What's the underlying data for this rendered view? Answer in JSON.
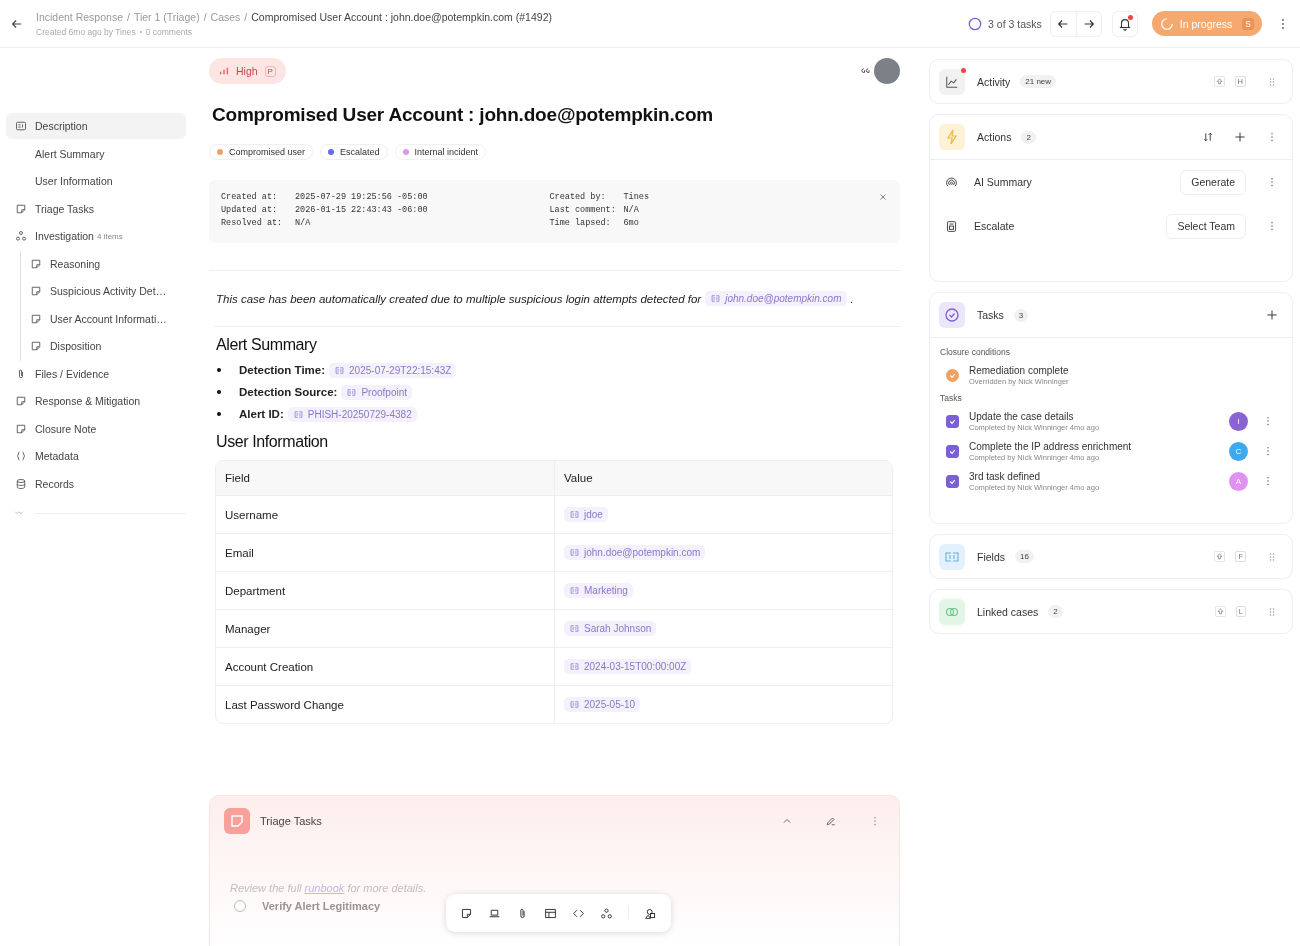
{
  "header": {
    "breadcrumb": [
      "Incident Response",
      "Tier 1 (Triage)",
      "Cases"
    ],
    "separator": "/",
    "tasks": {
      "label": "3 of 3 tasks"
    },
    "current": "Compromised User Account : john.doe@potempkin.com (#1492)",
    "created": "Created 6mo ago by Tines",
    "comments": "0 comments",
    "notifications_unread": true,
    "status": "In progress",
    "status_key": "S"
  },
  "sidebar": {
    "items": [
      {
        "label": "Description",
        "kind": "card",
        "selected": true,
        "children": [
          {
            "label": "Alert Summary",
            "kind": "plain",
            "selected": false
          },
          {
            "label": "User Information",
            "kind": "plain",
            "selected": false
          }
        ]
      },
      {
        "label": "Triage Tasks",
        "kind": "note",
        "selected": false
      },
      {
        "label": "Investigation",
        "count": "4 items",
        "kind": "graph",
        "selected": false,
        "children": [
          {
            "label": "Reasoning",
            "kind": "note",
            "selected": false
          },
          {
            "label": "Suspicious Activity Det…",
            "kind": "note",
            "selected": false
          },
          {
            "label": "User Account Informati…",
            "kind": "note",
            "selected": false
          },
          {
            "label": "Disposition",
            "kind": "note",
            "selected": false
          }
        ]
      },
      {
        "label": "Files / Evidence",
        "kind": "clip",
        "selected": false
      },
      {
        "label": "Response & Mitigation",
        "kind": "note",
        "selected": false
      },
      {
        "label": "Closure Note",
        "kind": "note",
        "selected": false
      },
      {
        "label": "Metadata",
        "kind": "braces",
        "selected": false
      },
      {
        "label": "Records",
        "kind": "db",
        "selected": false
      }
    ]
  },
  "case": {
    "priority": "High",
    "priority_key": "P",
    "title": "Compromised User Account : john.doe@potempkin.com",
    "tags": [
      {
        "label": "Compromised user",
        "color": "#f0a060"
      },
      {
        "label": "Escalated",
        "color": "#6a6ae8"
      },
      {
        "label": "Internal incident",
        "color": "#d89af0"
      }
    ],
    "info_left": [
      {
        "label": "Created at:",
        "value": "2025-07-29 19:25:56 -05:00"
      },
      {
        "label": "Updated at:",
        "value": "2026-01-15 22:43:43 -06:00"
      },
      {
        "label": "Resolved at:",
        "value": "N/A"
      }
    ],
    "info_right": [
      {
        "label": "Created by:",
        "value": "Tines"
      },
      {
        "label": "Last comment:",
        "value": "N/A"
      },
      {
        "label": "Time lapsed:",
        "value": "6mo"
      }
    ],
    "description": "This case has been automatically created due to multiple suspicious login attempts detected for",
    "description_chip": "john.doe@potempkin.com",
    "description_end": ".",
    "alert_heading": "Alert Summary",
    "alert_items": [
      {
        "label": "Detection Time:",
        "value": "2025-07-29T22:15:43Z"
      },
      {
        "label": "Detection Source:",
        "value": "Proofpoint"
      },
      {
        "label": "Alert ID:",
        "value": "PHISH-20250729-4382"
      }
    ],
    "user_heading": "User Information",
    "table": {
      "columns": [
        "Field",
        "Value"
      ],
      "rows": [
        [
          "Username",
          "jdoe"
        ],
        [
          "Email",
          "john.doe@potempkin.com"
        ],
        [
          "Department",
          "Marketing"
        ],
        [
          "Manager",
          "Sarah Johnson"
        ],
        [
          "Account Creation",
          "2024-03-15T00:00:00Z"
        ],
        [
          "Last Password Change",
          "2025-05-10"
        ]
      ]
    },
    "triage": {
      "title": "Triage Tasks",
      "text_before": "Review the full",
      "link": "runbook",
      "text_after": "for more details.",
      "task": "Verify Alert Legitimacy",
      "task_checked": false
    }
  },
  "panels": {
    "activity": {
      "title": "Activity",
      "badge": "21 new",
      "unread": true,
      "key": "H"
    },
    "actions": {
      "title": "Actions",
      "count": "2",
      "rows": [
        {
          "kind": "ai",
          "label": "AI Summary",
          "button": "Generate"
        },
        {
          "kind": "escalate",
          "label": "Escalate",
          "button": "Select Team"
        }
      ]
    },
    "tasks": {
      "title": "Tasks",
      "count": "3",
      "closure_label": "Closure conditions",
      "condition": {
        "title": "Remediation complete",
        "sub": "Overridden by Nick Winninger",
        "checked": true
      },
      "tasks_label": "Tasks",
      "items": [
        {
          "title": "Update the case details",
          "sub": "Completed by Nick Winninger 4mo ago",
          "checked": true,
          "avatar": "I",
          "color": "#8a63d2"
        },
        {
          "title": "Complete the IP address enrichment",
          "sub": "Completed by Nick Winninger 4mo ago",
          "checked": true,
          "avatar": "C",
          "color": "#3fa9f0"
        },
        {
          "title": "3rd task defined",
          "sub": "Completed by Nick Winninger 4mo ago",
          "checked": true,
          "avatar": "A",
          "color": "#df92ef"
        }
      ]
    },
    "fields": {
      "title": "Fields",
      "count": "16",
      "key": "F"
    },
    "linked": {
      "title": "Linked cases",
      "count": "2",
      "key": "L"
    }
  }
}
